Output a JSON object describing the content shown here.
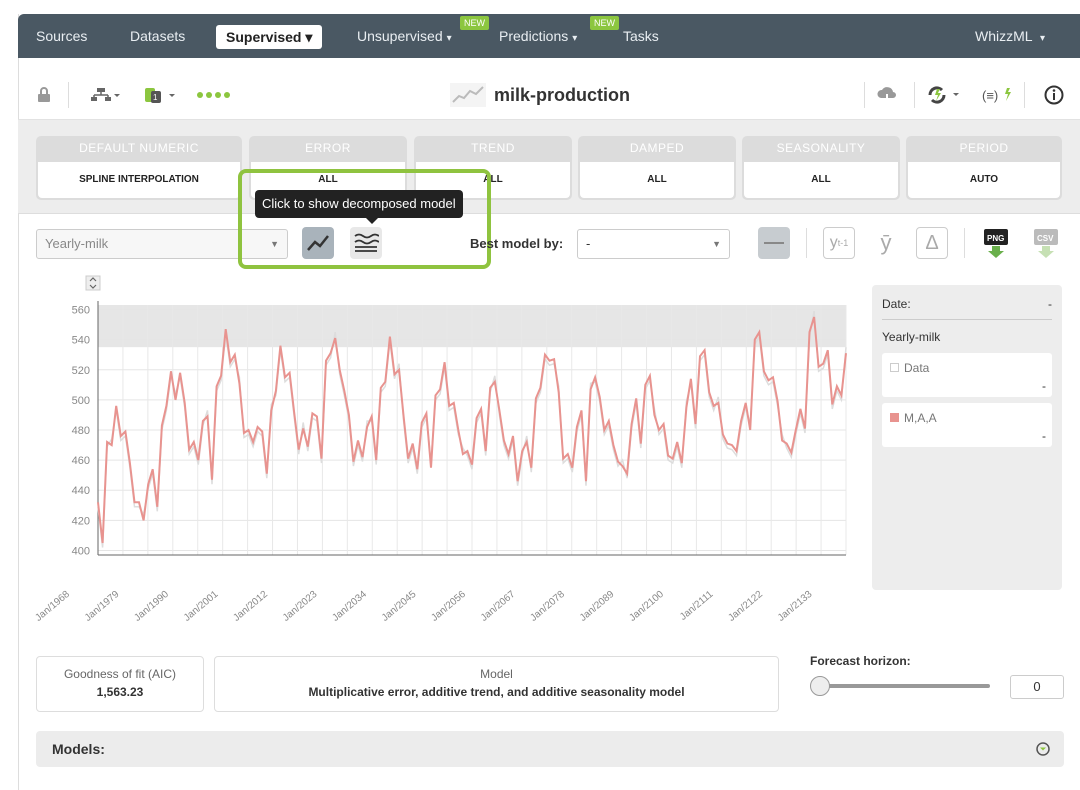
{
  "nav": {
    "sources": "Sources",
    "datasets": "Datasets",
    "supervised": "Supervised",
    "unsupervised": "Unsupervised",
    "predictions": "Predictions",
    "tasks": "Tasks",
    "whizzml": "WhizzML",
    "new_badge": "NEW"
  },
  "toolbar": {
    "title": "milk-production",
    "icons": [
      "lock-icon",
      "model-tree-icon",
      "dataset-icon",
      "progress-dots-icon",
      "cloud-download-icon",
      "reload-icon",
      "formula-icon",
      "info-icon"
    ]
  },
  "params": [
    {
      "header": "DEFAULT NUMERIC",
      "value": "SPLINE INTERPOLATION"
    },
    {
      "header": "ERROR",
      "value": "ALL"
    },
    {
      "header": "TREND",
      "value": "ALL"
    },
    {
      "header": "DAMPED",
      "value": "ALL"
    },
    {
      "header": "SEASONALITY",
      "value": "ALL"
    },
    {
      "header": "PERIOD",
      "value": "AUTO"
    }
  ],
  "controls": {
    "field_select": "Yearly-milk",
    "tooltip": "Click to show decomposed model",
    "best_model_label": "Best model by:",
    "best_model_value": "-",
    "btn_y_lag": "y",
    "btn_y_lag_sub": "t-1",
    "btn_y_mean": "ȳ",
    "btn_delta": "Δ",
    "btn_png": "PNG",
    "btn_csv": "CSV"
  },
  "legend": {
    "date_label": "Date:",
    "date_value": "-",
    "field": "Yearly-milk",
    "data_label": "Data",
    "data_value": "-",
    "model_label": "M,A,A",
    "model_value": "-",
    "model_color": "#e8938f"
  },
  "chart_data": {
    "type": "line",
    "x_tick_labels": [
      "Jan/1968",
      "Jan/1979",
      "Jan/1990",
      "Jan/2001",
      "Jan/2012",
      "Jan/2023",
      "Jan/2034",
      "Jan/2045",
      "Jan/2056",
      "Jan/2067",
      "Jan/2078",
      "Jan/2089",
      "Jan/2100",
      "Jan/2111",
      "Jan/2122",
      "Jan/2133"
    ],
    "y_ticks": [
      400,
      420,
      440,
      460,
      480,
      500,
      520,
      540,
      560
    ],
    "ylim": [
      397,
      563
    ],
    "grid": true,
    "series": [
      {
        "name": "M,A,A",
        "color": "#e8938f",
        "values": [
          432,
          405,
          472,
          470,
          496,
          476,
          479,
          458,
          432,
          432,
          420,
          444,
          454,
          429,
          483,
          496,
          519,
          500,
          518,
          498,
          467,
          472,
          460,
          486,
          489,
          447,
          509,
          516,
          547,
          525,
          530,
          511,
          478,
          480,
          472,
          482,
          479,
          451,
          493,
          506,
          536,
          515,
          518,
          492,
          467,
          481,
          469,
          491,
          489,
          461,
          526,
          531,
          541,
          520,
          506,
          490,
          459,
          473,
          462,
          482,
          489,
          460,
          508,
          512,
          542,
          517,
          520,
          489,
          461,
          471,
          454,
          485,
          491,
          455,
          503,
          507,
          525,
          496,
          498,
          480,
          464,
          466,
          457,
          488,
          494,
          466,
          508,
          512,
          493,
          473,
          464,
          476,
          446,
          466,
          472,
          455,
          501,
          508,
          530,
          526,
          527,
          505,
          461,
          464,
          455,
          482,
          493,
          446,
          507,
          515,
          502,
          480,
          486,
          470,
          459,
          456,
          451,
          484,
          501,
          471,
          510,
          516,
          490,
          480,
          484,
          463,
          461,
          472,
          458,
          495,
          514,
          484,
          529,
          533,
          505,
          496,
          498,
          477,
          471,
          470,
          466,
          486,
          498,
          480,
          540,
          545,
          519,
          513,
          515,
          499,
          473,
          471,
          465,
          480,
          494,
          481,
          545,
          555,
          522,
          524,
          533,
          497,
          509,
          503,
          531
        ]
      }
    ]
  },
  "bottom": {
    "aic_title": "Goodness of fit (AIC)",
    "aic_value": "1,563.23",
    "model_title": "Model",
    "model_value": "Multiplicative error, additive trend, and additive seasonality model",
    "forecast_label": "Forecast horizon:",
    "forecast_value": "0",
    "models_label": "Models:"
  }
}
